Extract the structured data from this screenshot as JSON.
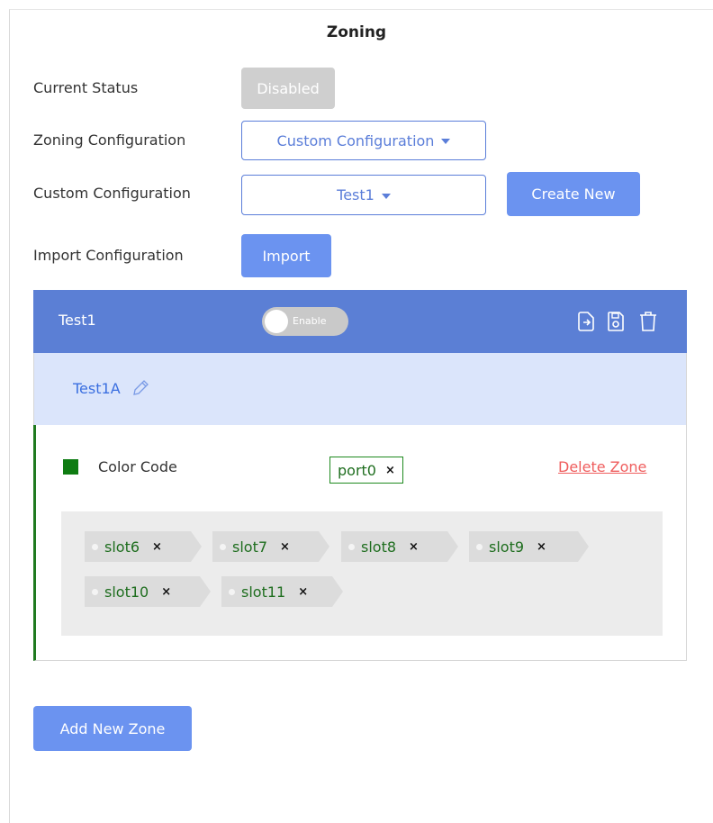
{
  "page": {
    "title": "Zoning"
  },
  "status": {
    "label": "Current Status",
    "button": "Disabled"
  },
  "zoning_config": {
    "label": "Zoning Configuration",
    "value": "Custom Configuration"
  },
  "custom_config": {
    "label": "Custom Configuration",
    "value": "Test1",
    "create_button": "Create New"
  },
  "import_config": {
    "label": "Import Configuration",
    "button": "Import"
  },
  "panel": {
    "title": "Test1",
    "toggle_label": "Enable",
    "icons": [
      "export-icon",
      "save-icon",
      "trash-icon"
    ],
    "header_color": "#5b7fd5"
  },
  "subpanel": {
    "title": "Test1A"
  },
  "zone": {
    "color_label": "Color Code",
    "color": "#0e7c12",
    "port": "port0",
    "port_remove": "×",
    "delete_label": "Delete Zone",
    "slots": [
      {
        "label": "slot6",
        "remove": "×"
      },
      {
        "label": "slot7",
        "remove": "×"
      },
      {
        "label": "slot8",
        "remove": "×"
      },
      {
        "label": "slot9",
        "remove": "×"
      },
      {
        "label": "slot10",
        "remove": "×"
      },
      {
        "label": "slot11",
        "remove": "×"
      }
    ]
  },
  "add_zone_button": "Add New Zone",
  "colors": {
    "accent": "#6b93f0",
    "danger": "#ef5d5d",
    "zone_green": "#1f7a1f"
  }
}
